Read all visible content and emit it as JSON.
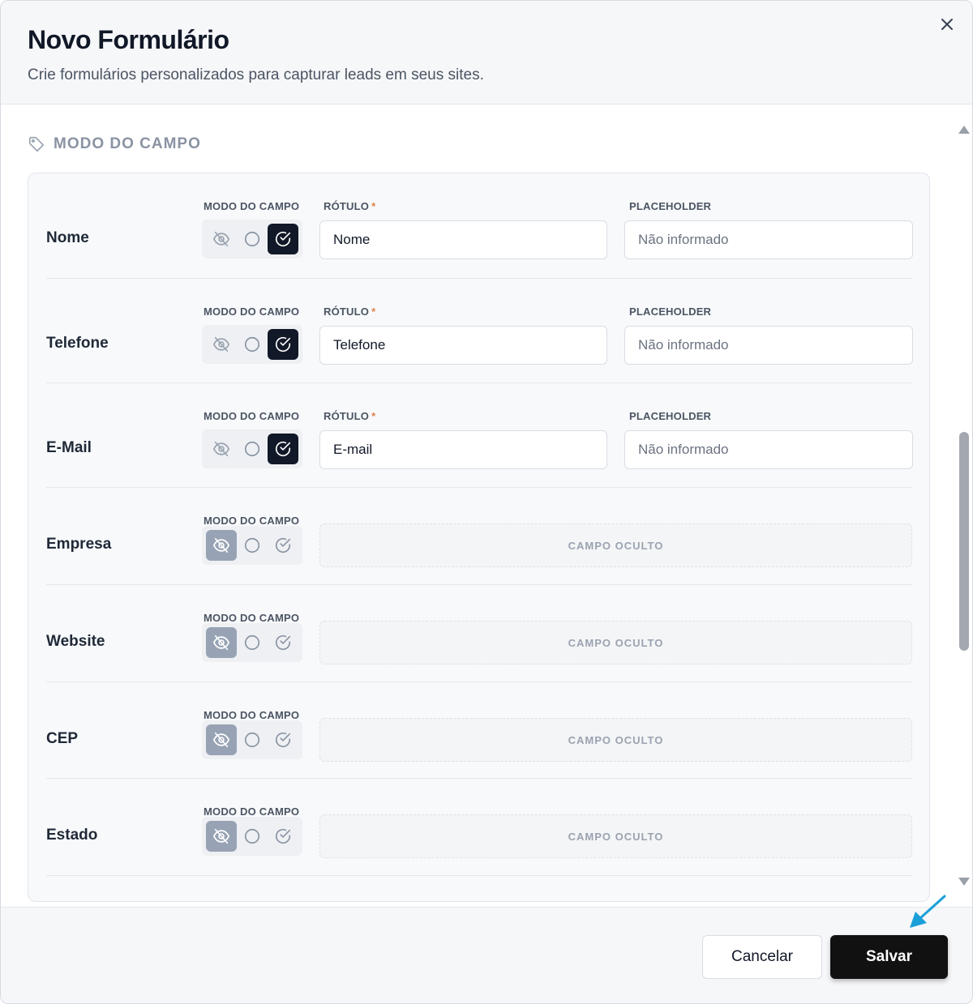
{
  "header": {
    "title": "Novo Formulário",
    "subtitle": "Crie formulários personalizados para capturar leads em seus sites."
  },
  "section": {
    "title": "MODO DO CAMPO"
  },
  "labels": {
    "mode": "MODO DO CAMPO",
    "label": "RÓTULO",
    "required_mark": "*",
    "placeholder": "PLACEHOLDER",
    "hidden_field": "CAMPO OCULTO"
  },
  "fields": [
    {
      "name": "Nome",
      "mode": "required",
      "label_value": "Nome",
      "placeholder_value": "Não informado"
    },
    {
      "name": "Telefone",
      "mode": "required",
      "label_value": "Telefone",
      "placeholder_value": "Não informado"
    },
    {
      "name": "E-Mail",
      "mode": "required",
      "label_value": "E-mail",
      "placeholder_value": "Não informado"
    },
    {
      "name": "Empresa",
      "mode": "hidden"
    },
    {
      "name": "Website",
      "mode": "hidden"
    },
    {
      "name": "CEP",
      "mode": "hidden"
    },
    {
      "name": "Estado",
      "mode": "hidden"
    }
  ],
  "footer": {
    "cancel_label": "Cancelar",
    "save_label": "Salvar"
  },
  "colors": {
    "accent_dark": "#111827",
    "hidden_active": "#97a3b4",
    "required_mark": "#e0834b",
    "pointer_arrow": "#1a9fd9"
  }
}
